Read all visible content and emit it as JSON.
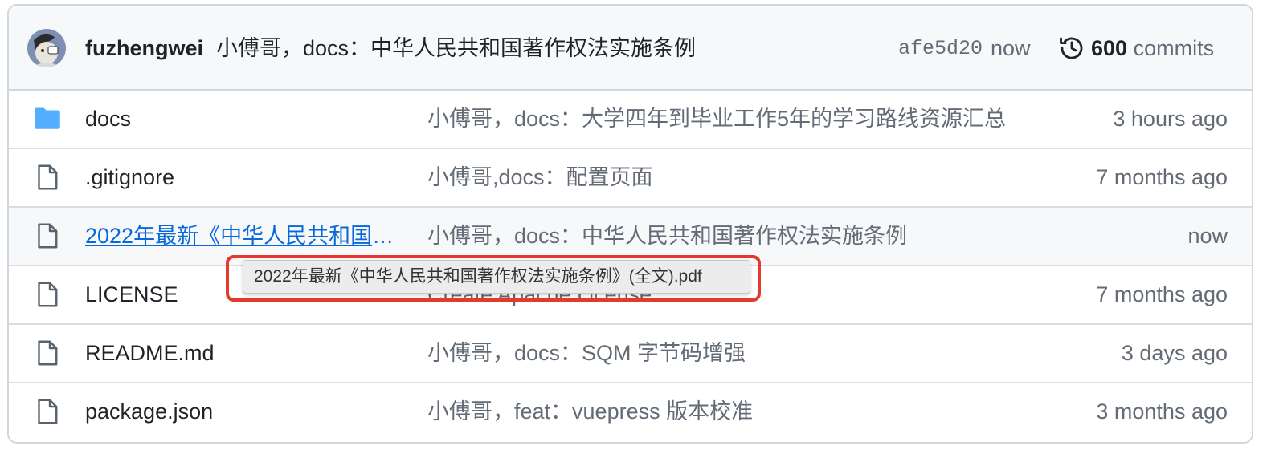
{
  "latest_commit": {
    "author": "fuzhengwei",
    "message": "小傅哥，docs：中华人民共和国著作权法实施条例",
    "sha": "afe5d20",
    "time": "now",
    "commit_count": "600",
    "commit_count_label": "commits"
  },
  "files": [
    {
      "name": "docs",
      "type": "folder",
      "icon": "folder-icon",
      "message": "小傅哥，docs：大学四年到毕业工作5年的学习路线资源汇总",
      "age": "3 hours ago"
    },
    {
      "name": ".gitignore",
      "type": "file",
      "icon": "file-icon",
      "message": "小傅哥,docs：配置页面",
      "age": "7 months ago"
    },
    {
      "name": "2022年最新《中华人民共和国著作权法实施条例》(全文).pdf",
      "type": "file",
      "icon": "file-icon",
      "message": "小傅哥，docs：中华人民共和国著作权法实施条例",
      "age": "now",
      "hovered": true
    },
    {
      "name": "LICENSE",
      "type": "file",
      "icon": "file-icon",
      "message": "Create Apache License",
      "age": "7 months ago"
    },
    {
      "name": "README.md",
      "type": "file",
      "icon": "file-icon",
      "message": "小傅哥，docs：SQM 字节码增强",
      "age": "3 days ago"
    },
    {
      "name": "package.json",
      "type": "file",
      "icon": "file-icon",
      "message": "小傅哥，feat：vuepress 版本校准",
      "age": "3 months ago"
    }
  ],
  "tooltip": {
    "text": "2022年最新《中华人民共和国著作权法实施条例》(全文).pdf"
  },
  "colors": {
    "link": "#0969da",
    "folder": "#54aeff",
    "muted": "#636c76",
    "highlight": "#e23b2e"
  }
}
